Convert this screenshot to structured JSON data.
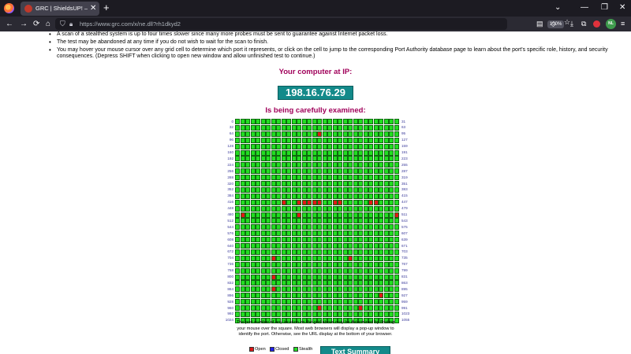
{
  "browser": {
    "tab_title": "GRC | ShieldsUP! — Service Po",
    "tab_close": "✕",
    "new_tab": "+",
    "window_controls": [
      "⌄",
      "—",
      "❐",
      "✕"
    ],
    "nav_buttons": [
      "←",
      "→",
      "⟳",
      "⌂"
    ],
    "url": "https://www.grc.com/x/ne.dll?rh1dkyd2",
    "zoom": "100%",
    "avatar_initials": "NL",
    "icons": [
      "firefox-logo",
      "shield-icon",
      "lock-icon",
      "reader-icon",
      "star-icon",
      "pocket-icon",
      "download-icon",
      "extensions-icon",
      "menu-icon"
    ]
  },
  "content": {
    "bullets": [
      "A scan of a stealthed system is up to four times slower since many more probes must be sent to guarantee against Internet packet loss.",
      "The test may be abandoned at any time if you do not wish to wait for the scan to finish.",
      "You may hover your mouse cursor over any grid cell to determine which port it represents, or click on the cell to jump to the corresponding Port Authority database page to learn about the port's specific role, history, and security consequences. (Depress SHIFT when clicking to open new window and allow unfinished test to continue.)"
    ],
    "ip_heading": "Your computer at IP:",
    "ip_address": "198.16.76.29",
    "exam_heading": "Is being carefully examined:",
    "grid_note": "The port number of any location on the grid above may be determined by floating your mouse over the square. Most web browsers will display a pop-up window to identify the port. Otherwise, see the URL display at the bottom of your browser.",
    "legend": {
      "open": "Open",
      "closed": "Closed",
      "stealth": "Stealth"
    },
    "summary_button": "Text Summary"
  },
  "port_grid": {
    "columns": 32,
    "left_labels": [
      "0",
      "32",
      "64",
      "96",
      "128",
      "160",
      "192",
      "224",
      "256",
      "288",
      "320",
      "352",
      "384",
      "416",
      "448",
      "480",
      "512",
      "544",
      "576",
      "608",
      "640",
      "672",
      "704",
      "736",
      "768",
      "800",
      "832",
      "864",
      "896",
      "928",
      "960",
      "992",
      "1024"
    ],
    "right_labels": [
      "31",
      "63",
      "95",
      "127",
      "159",
      "191",
      "223",
      "255",
      "287",
      "319",
      "351",
      "383",
      "415",
      "447",
      "479",
      "511",
      "543",
      "575",
      "607",
      "639",
      "671",
      "703",
      "735",
      "767",
      "799",
      "831",
      "863",
      "895",
      "927",
      "959",
      "991",
      "1023",
      "1055"
    ],
    "open_cells": [
      [
        2,
        16
      ],
      [
        13,
        9
      ],
      [
        13,
        12
      ],
      [
        13,
        13
      ],
      [
        13,
        14
      ],
      [
        13,
        15
      ],
      [
        13,
        16
      ],
      [
        13,
        19
      ],
      [
        13,
        20
      ],
      [
        13,
        26
      ],
      [
        13,
        27
      ],
      [
        15,
        1
      ],
      [
        15,
        12
      ],
      [
        15,
        31
      ],
      [
        22,
        7
      ],
      [
        22,
        22
      ],
      [
        25,
        7
      ],
      [
        27,
        7
      ],
      [
        28,
        28
      ],
      [
        30,
        16
      ],
      [
        30,
        24
      ]
    ],
    "colors": {
      "stealth": "#22dd22",
      "open": "#e01818",
      "closed": "#2020ee"
    }
  }
}
